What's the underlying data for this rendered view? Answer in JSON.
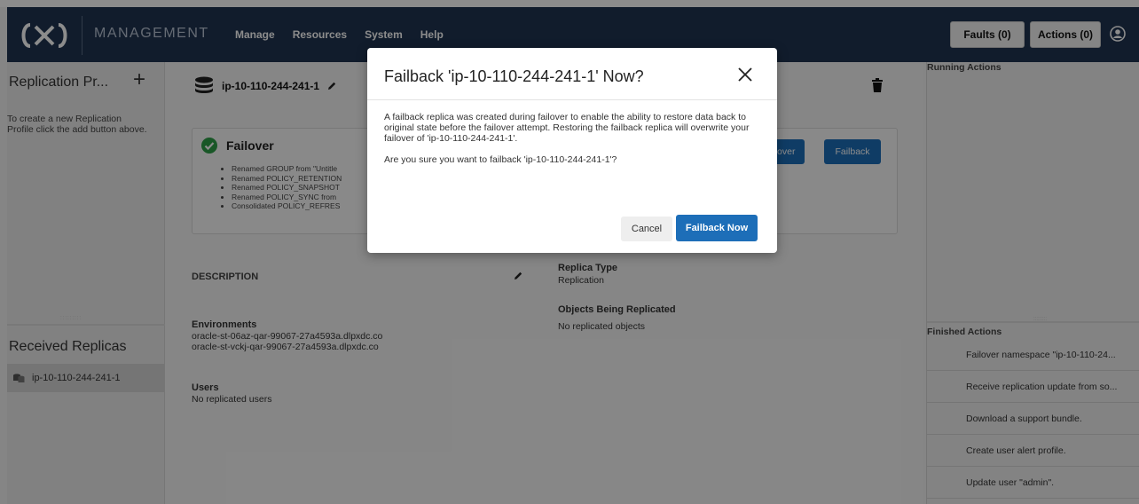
{
  "header": {
    "brand": "MANAGEMENT",
    "nav": [
      "Manage",
      "Resources",
      "System",
      "Help"
    ],
    "faults_label": "Faults (0)",
    "actions_label": "Actions (0)"
  },
  "sidebar": {
    "title": "Replication Pr...",
    "plus_label": "+",
    "help_text": "To create a new Replication Profile click the add button above.",
    "received_title": "Received Replicas",
    "received_items": [
      {
        "label": "ip-10-110-244-241-1"
      }
    ]
  },
  "main": {
    "title": "ip-10-110-244-241-1",
    "failover_card": {
      "status": "Failover",
      "items": [
        "Renamed GROUP from \"Untitle",
        "Renamed POLICY_RETENTION",
        "Renamed POLICY_SNAPSHOT",
        "Renamed POLICY_SYNC from",
        "Consolidated POLICY_REFRES"
      ],
      "failover_btn": "ailover",
      "failback_btn": "Failback"
    },
    "description_label": "DESCRIPTION",
    "environments_label": "Environments",
    "environments": [
      "oracle-st-06az-qar-99067-27a4593a.dlpxdc.co",
      "oracle-st-vckj-qar-99067-27a4593a.dlpxdc.co"
    ],
    "users_label": "Users",
    "users_value": "No replicated users",
    "replica_type_label": "Replica Type",
    "replica_type_value": "Replication",
    "objects_label": "Objects Being Replicated",
    "objects_value": "No replicated objects"
  },
  "right_panel": {
    "running_title": "Running Actions",
    "finished_title": "Finished Actions",
    "finished_items": [
      "Failover namespace \"ip-10-110-24...",
      "Receive replication update from so...",
      "Download a support bundle.",
      "Create user alert profile.",
      "Update user \"admin\"."
    ]
  },
  "dialog": {
    "title": "Failback 'ip-10-110-244-241-1' Now?",
    "body_1": "A failback replica was created during failover to enable the ability to restore data back to original state before the failover attempt. Restoring the failback replica will overwrite your failover of 'ip-10-110-244-241-1'.",
    "body_2": "Are you sure you want to failback 'ip-10-110-244-241-1'?",
    "cancel_label": "Cancel",
    "confirm_label": "Failback Now"
  },
  "colors": {
    "header_bg": "#1f3350",
    "primary": "#1d6eb8",
    "success": "#2e9e47"
  }
}
